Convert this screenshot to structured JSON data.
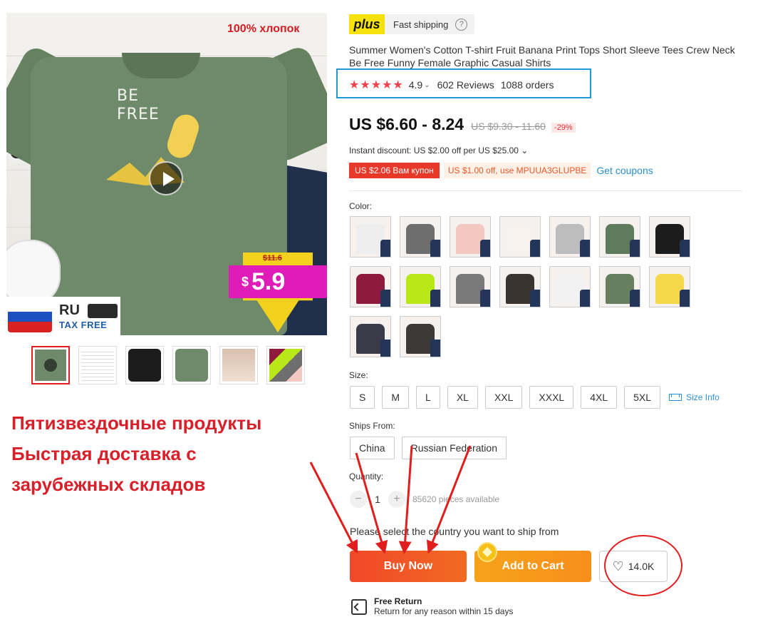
{
  "main_image": {
    "overlay_text": "100% хлопок",
    "print_text_line1": "BE",
    "print_text_line2": "FREE",
    "sticker_old_price": "$11.6",
    "sticker_currency": "$",
    "sticker_price": "5.9",
    "badge_country": "RU",
    "badge_tax": "TAX FREE"
  },
  "thumbnails": [
    {
      "label": "video"
    },
    {
      "label": "size-chart"
    },
    {
      "label": "black"
    },
    {
      "label": "green"
    },
    {
      "label": "model"
    },
    {
      "label": "collage"
    }
  ],
  "promo": {
    "line1": "Пятизвездочные продукты",
    "line2": "Быстрая доставка с",
    "line3": "зарубежных складов"
  },
  "plus": {
    "logo": "plus",
    "text": "Fast shipping",
    "info": "?"
  },
  "product": {
    "title": "Summer Women's Cotton T-shirt Fruit Banana Print Tops Short Sleeve Tees Crew Neck Be Free Funny Female Graphic Casual Shirts",
    "stars": "★★★★★",
    "rating": "4.9",
    "reviews": "602 Reviews",
    "orders": "1088 orders",
    "price": "US $6.60 - 8.24",
    "old_price": "US $9.30 - 11.60",
    "discount": "-29%",
    "instant_discount": "Instant discount: US $2.00 off per US $25.00 ⌄",
    "coupon_red": "US $2.06 Вам купон",
    "coupon_orange": "US $1.00 off, use MPUUA3GLUPBE",
    "get_coupons": "Get coupons"
  },
  "color": {
    "label": "Color:",
    "swatches": [
      {
        "color": "#eeeeee",
        "name": "white"
      },
      {
        "color": "#6e6e6e",
        "name": "gray"
      },
      {
        "color": "#f2c8c0",
        "name": "pink"
      },
      {
        "color": "#f7f2ee",
        "name": "cream"
      },
      {
        "color": "#bdbdbd",
        "name": "light-gray"
      },
      {
        "color": "#5f7a5c",
        "name": "army-green"
      },
      {
        "color": "#1c1c1c",
        "name": "black"
      },
      {
        "color": "#8e1a3e",
        "name": "wine"
      },
      {
        "color": "#b8e818",
        "name": "lime"
      },
      {
        "color": "#7a7a7a",
        "name": "dark-gray"
      },
      {
        "color": "#3a3431",
        "name": "charcoal"
      },
      {
        "color": "#f2f2f2",
        "name": "white-2"
      },
      {
        "color": "#66805f",
        "name": "green-2"
      },
      {
        "color": "#f5d94a",
        "name": "yellow"
      },
      {
        "color": "#3a3a48",
        "name": "navy-dark"
      },
      {
        "color": "#3c3a38",
        "name": "dark-brown"
      }
    ]
  },
  "size": {
    "label": "Size:",
    "options": [
      "S",
      "M",
      "L",
      "XL",
      "XXL",
      "XXXL",
      "4XL",
      "5XL"
    ],
    "info": "Size Info"
  },
  "ships_from": {
    "label": "Ships From:",
    "options": [
      "China",
      "Russian Federation"
    ]
  },
  "quantity": {
    "label": "Quantity:",
    "minus": "−",
    "value": "1",
    "plus": "+",
    "available": "85620 pieces available"
  },
  "ship_note": "Please select the country you want to ship from",
  "actions": {
    "buy_now": "Buy Now",
    "add_to_cart": "Add to Cart",
    "wishlist_count": "14.0K"
  },
  "free_return": {
    "title": "Free Return",
    "subtitle": "Return for any reason within 15 days"
  },
  "colors": {
    "accent_red": "#e8382a",
    "link_blue": "#2a8fd0",
    "annotation_red": "#e01e1e",
    "annotation_blue": "#2196d9"
  }
}
